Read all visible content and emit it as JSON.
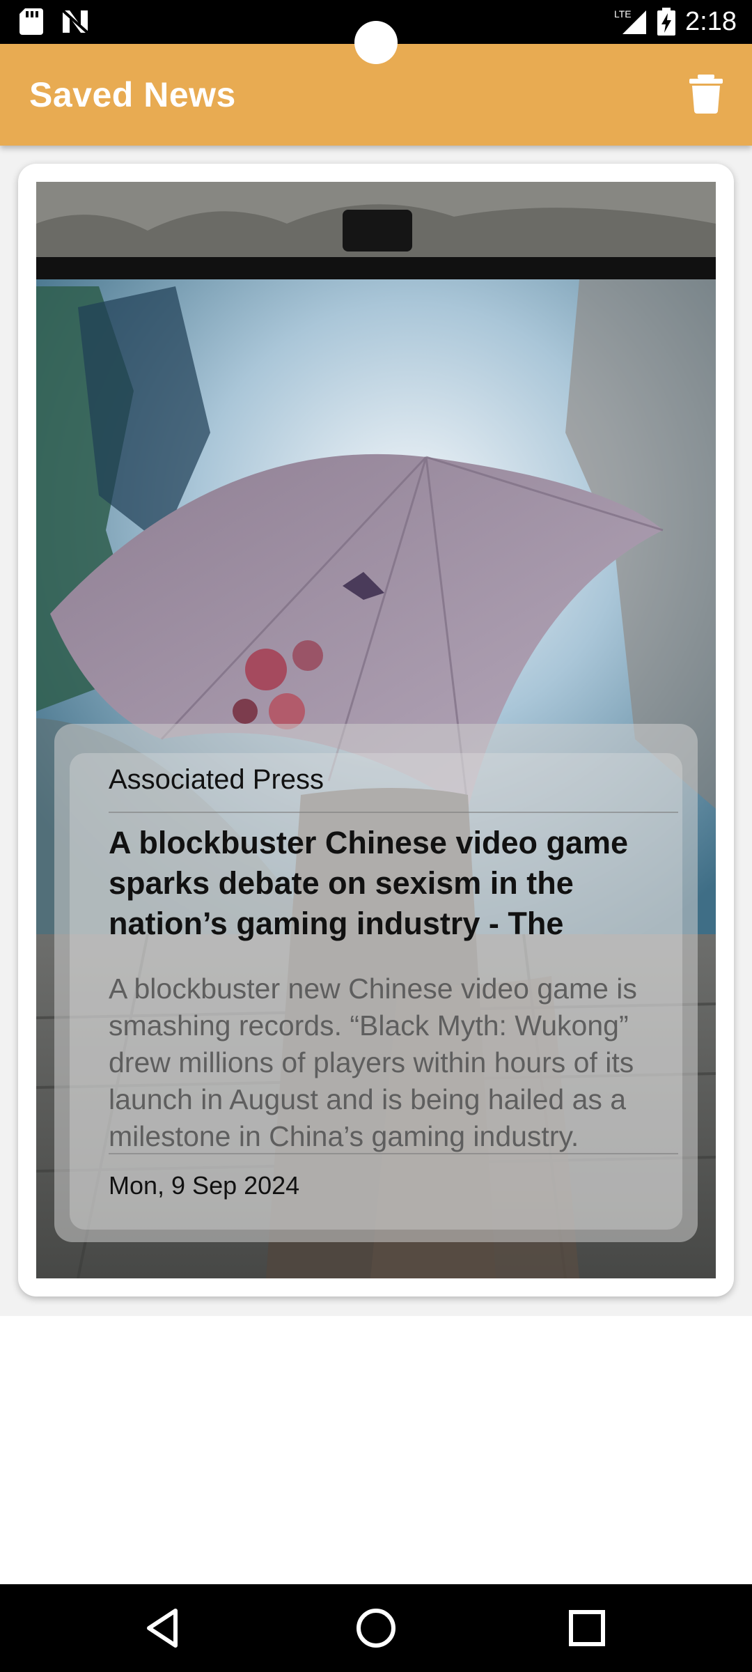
{
  "status_bar": {
    "time": "2:18",
    "network": "LTE",
    "icons": [
      "sd-card-icon",
      "n-logo-icon",
      "signal-icon",
      "battery-charging-icon"
    ]
  },
  "app_bar": {
    "title": "Saved News",
    "action_icon": "trash-icon",
    "color": "#e8ab52"
  },
  "articles": [
    {
      "source": "Associated Press",
      "title": "A blockbuster Chinese video game sparks debate on sexism in the nation’s gaming industry - The",
      "description": "A blockbuster new Chinese video game is smashing records. “Black Myth: Wukong” drew millions of players within hours of its launch in August and is being hailed as a milestone in China’s gaming industry.",
      "date": "Mon, 9 Sep 2024"
    }
  ],
  "nav_bar": {
    "buttons": [
      "back-icon",
      "home-icon",
      "recents-icon"
    ]
  }
}
